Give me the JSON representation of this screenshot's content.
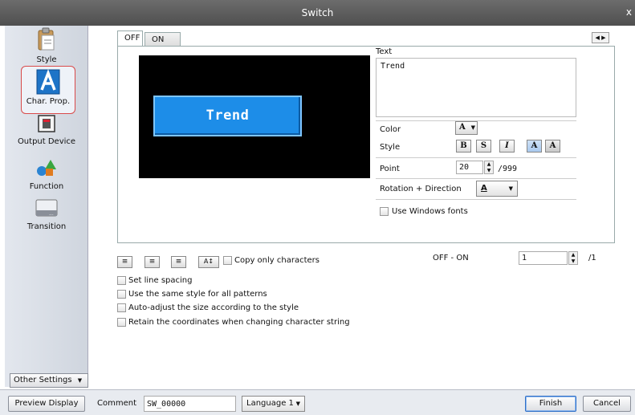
{
  "window": {
    "title": "Switch",
    "close_label": "x"
  },
  "sidebar": {
    "items": [
      {
        "label": "Style"
      },
      {
        "label": "Char. Prop."
      },
      {
        "label": "Output Device"
      },
      {
        "label": "Function"
      },
      {
        "label": "Transition"
      }
    ],
    "other_settings_label": "Other Settings"
  },
  "tabs": [
    {
      "label": "OFF"
    },
    {
      "label": "ON"
    }
  ],
  "preview": {
    "button_text": "Trend"
  },
  "text_section": {
    "label": "Text",
    "value": "Trend"
  },
  "props": {
    "color_label": "Color",
    "color_glyph": "A",
    "style_label": "Style",
    "style_buttons": [
      "B",
      "S",
      "I",
      "A",
      "A"
    ],
    "point_label": "Point",
    "point_value": "20",
    "point_max": "/999",
    "rotation_label": "Rotation + Direction",
    "rotation_glyph": "A",
    "use_windows_fonts": "Use Windows fonts"
  },
  "options": {
    "copy_only_characters": "Copy only characters",
    "off_on_label": "OFF - ON",
    "off_on_value": "1",
    "off_on_max": "/1",
    "checkboxes": [
      "Set line spacing",
      "Use the same style for all patterns",
      "Auto-adjust the size according to the style",
      "Retain the coordinates when changing character string"
    ]
  },
  "bottom": {
    "preview_display": "Preview Display",
    "comment_label": "Comment",
    "comment_value": "SW_00000",
    "language_value": "Language 1",
    "finish": "Finish",
    "cancel": "Cancel"
  },
  "colors": {
    "accent": "#1d8de8",
    "selection_border": "#d94a4a",
    "titlebar": "#5a5a5a"
  }
}
